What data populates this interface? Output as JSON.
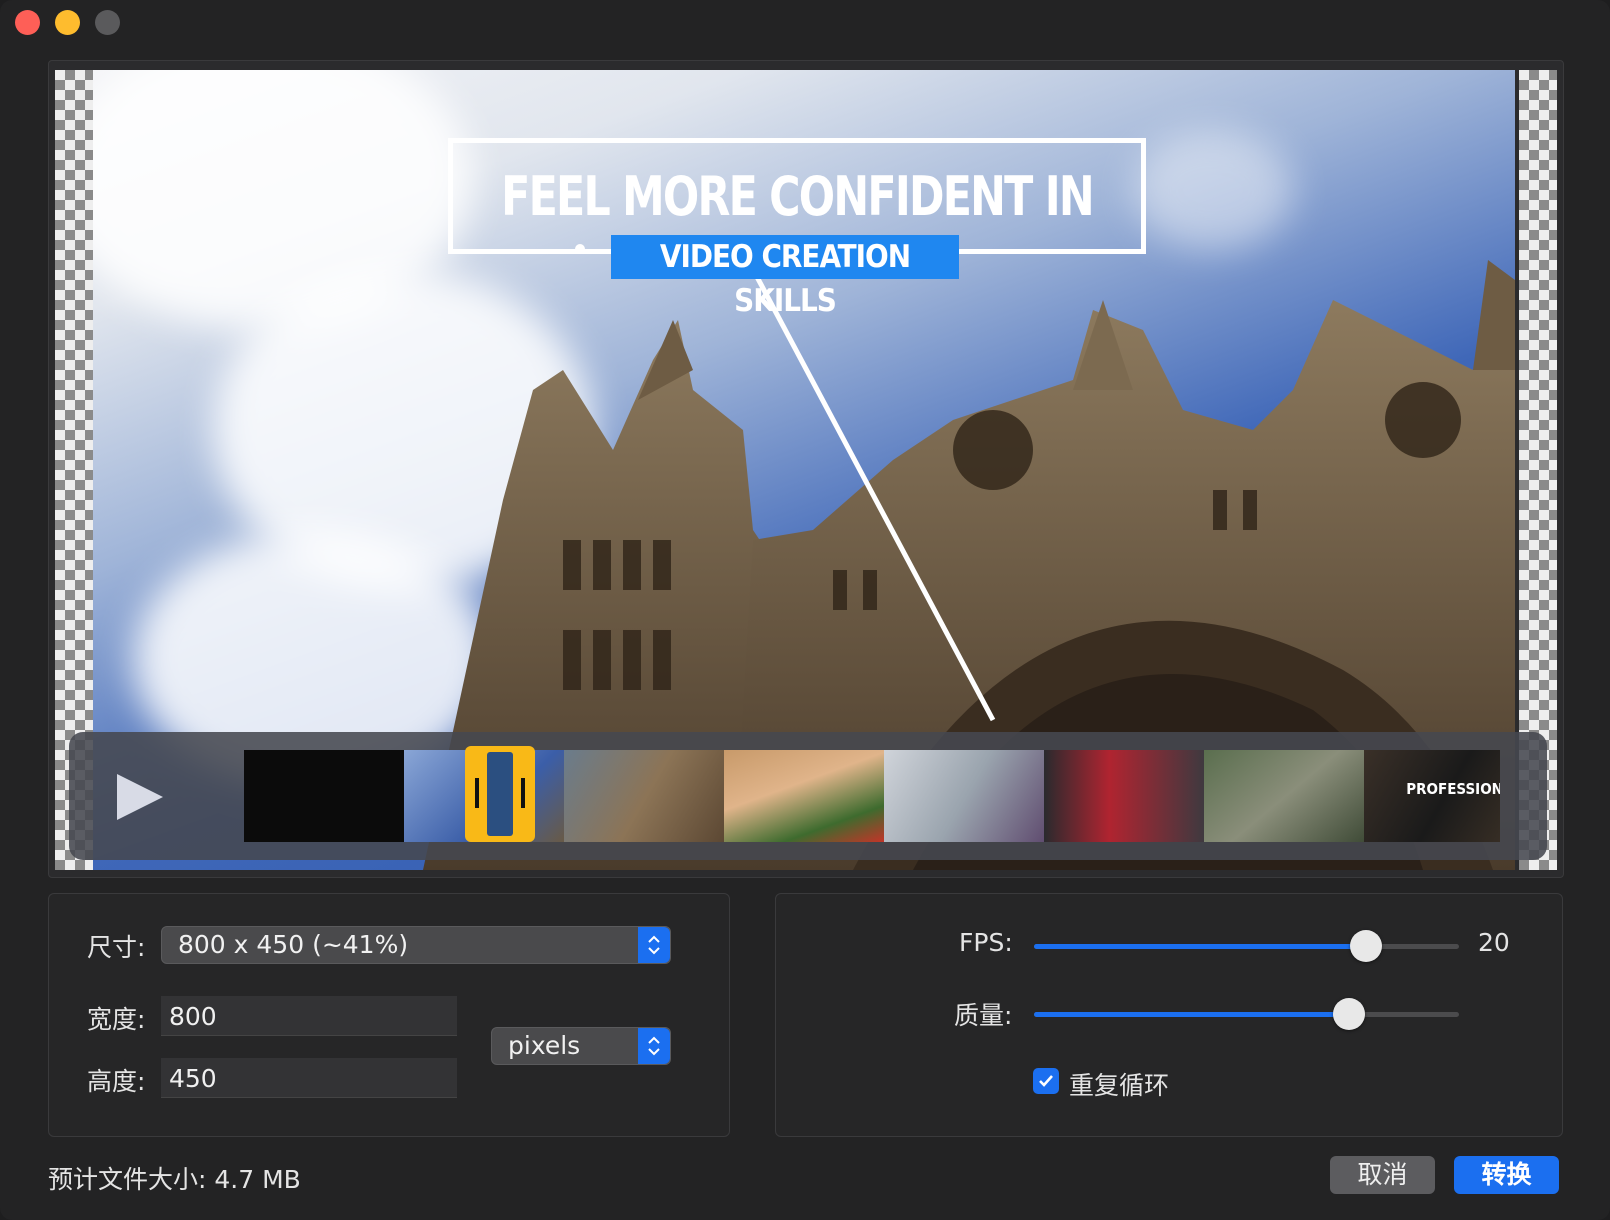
{
  "window": {
    "controls": [
      "close",
      "minimize",
      "zoom"
    ]
  },
  "preview": {
    "title_line1": "FEEL MORE CONFIDENT IN YOUR",
    "title_line2": "VIDEO CREATION SKILLS",
    "thumb_last_text": "PROFESSIONAL"
  },
  "size": {
    "label": "尺寸:",
    "value": "800 x 450 (~41%)"
  },
  "width": {
    "label": "宽度:",
    "value": "800"
  },
  "height": {
    "label": "高度:",
    "value": "450"
  },
  "unit": {
    "value": "pixels"
  },
  "fps": {
    "label": "FPS:",
    "value": "20",
    "fraction": 0.78
  },
  "quality": {
    "label": "质量:",
    "fraction": 0.74
  },
  "loop": {
    "label": "重复循环",
    "checked": true
  },
  "estimate": "预计文件大小: 4.7 MB",
  "buttons": {
    "cancel": "取消",
    "convert": "转换"
  },
  "colors": {
    "accent": "#1b6ff0",
    "scrubber": "#f9b917"
  }
}
